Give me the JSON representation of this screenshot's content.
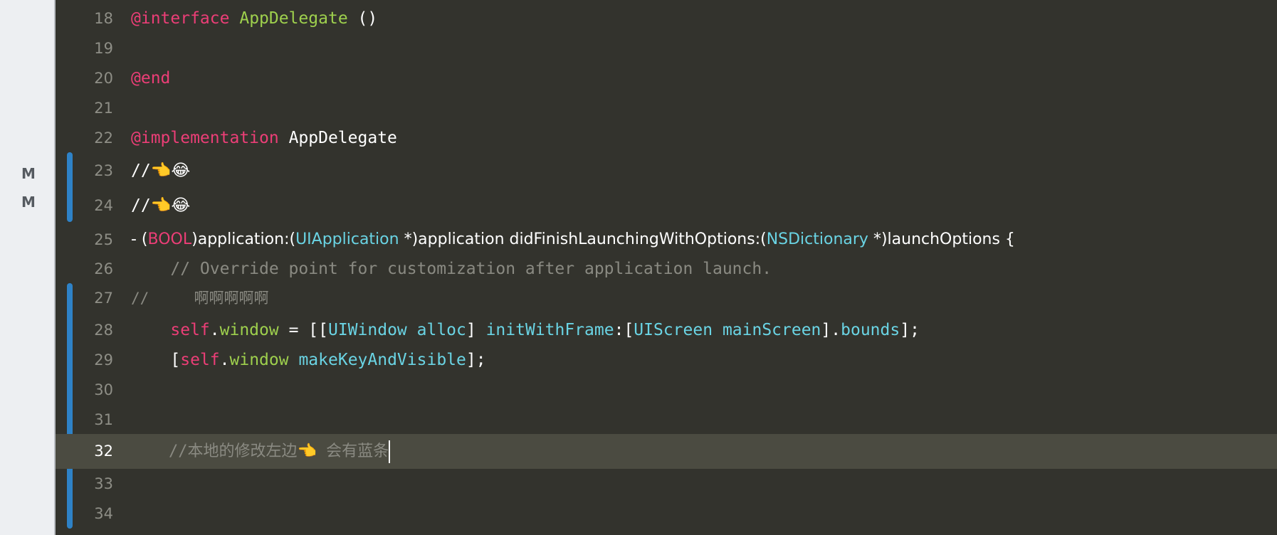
{
  "gutter": {
    "badges": [
      "M",
      "M"
    ]
  },
  "editor": {
    "current_line": "32",
    "lines": [
      {
        "num": "18",
        "t": [
          "@interface",
          " ",
          "AppDelegate",
          " ()"
        ]
      },
      {
        "num": "19",
        "t": []
      },
      {
        "num": "20",
        "t": [
          "@end"
        ]
      },
      {
        "num": "21",
        "t": []
      },
      {
        "num": "22",
        "t": [
          "@implementation",
          " AppDelegate"
        ]
      },
      {
        "num": "23",
        "t": [
          "//",
          "👈😂"
        ]
      },
      {
        "num": "24",
        "t": [
          "//",
          "👈😂"
        ]
      },
      {
        "num": "25",
        "t": [
          "- (",
          "BOOL",
          ")application:(",
          "UIApplication",
          " *)application didFinishLaunchingWithOptions:(",
          "NSDictionary",
          " *)launchOptions {"
        ]
      },
      {
        "num": "26",
        "t": [
          "    // Override point for customization after application launch."
        ]
      },
      {
        "num": "27",
        "t": [
          "//     啊啊啊啊啊"
        ]
      },
      {
        "num": "28",
        "t": [
          "    ",
          "self",
          ".",
          "window",
          " = [[",
          "UIWindow",
          " ",
          "alloc",
          "] ",
          "initWithFrame",
          ":[",
          "UIScreen",
          " ",
          "mainScreen",
          "].",
          "bounds",
          "];"
        ]
      },
      {
        "num": "29",
        "t": [
          "    [",
          "self",
          ".",
          "window",
          " ",
          "makeKeyAndVisible",
          "];"
        ]
      },
      {
        "num": "30",
        "t": []
      },
      {
        "num": "31",
        "t": []
      },
      {
        "num": "32",
        "t": [
          "    //本地的修改左边",
          "👈",
          " 会有蓝条"
        ]
      },
      {
        "num": "33",
        "t": []
      },
      {
        "num": "34",
        "t": []
      }
    ]
  }
}
